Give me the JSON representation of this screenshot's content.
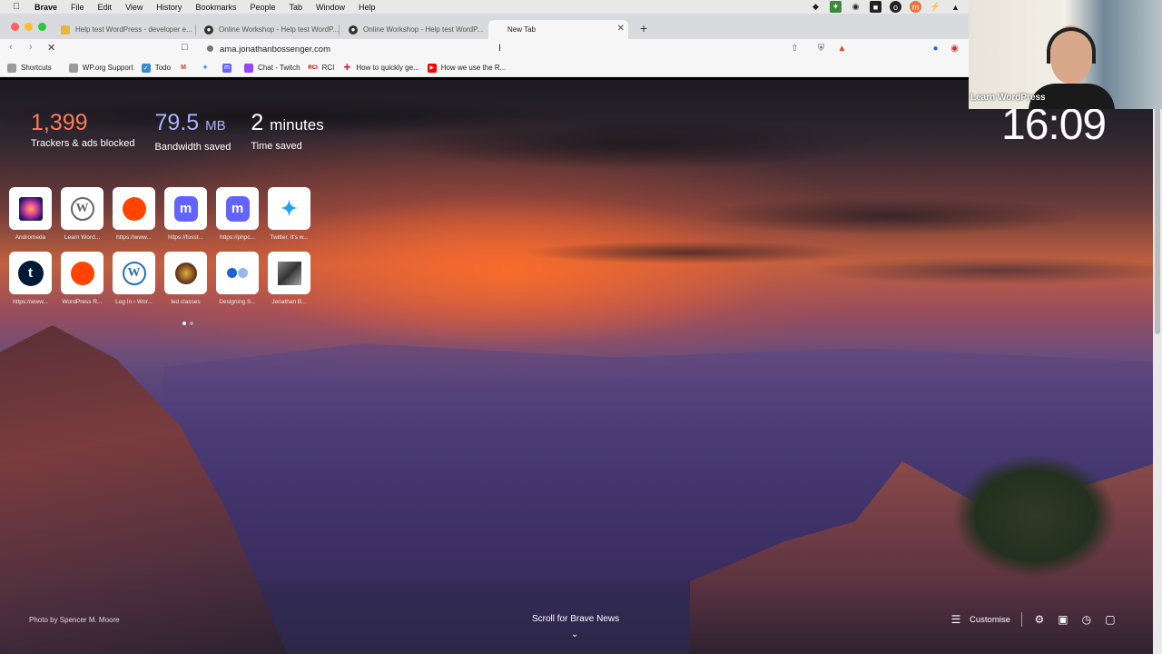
{
  "menubar": {
    "app": "Brave",
    "items": [
      "File",
      "Edit",
      "View",
      "History",
      "Bookmarks",
      "People",
      "Tab",
      "Window",
      "Help"
    ]
  },
  "tabs": [
    {
      "title": "Help test WordPress - developer e...",
      "icon": "wordpress-yellow-icon"
    },
    {
      "title": "Online Workshop - Help test WordP...",
      "icon": "github-icon"
    },
    {
      "title": "Online Workshop - Help test WordP...",
      "icon": "github-icon"
    },
    {
      "title": "New Tab",
      "icon": "blank-icon",
      "active": true
    }
  ],
  "toolbar": {
    "url": "ama.jonathanbossenger.com"
  },
  "bookmarks": [
    {
      "label": "Shortcuts",
      "icon": "folder-icon"
    },
    {
      "label": "WP.org Support",
      "icon": "folder-icon"
    },
    {
      "label": "Todo",
      "icon": "todo-icon"
    },
    {
      "label": "",
      "icon": "gmail-icon"
    },
    {
      "label": "",
      "icon": "twitter-icon"
    },
    {
      "label": "",
      "icon": "mastodon-icon"
    },
    {
      "label": "Chat - Twitch",
      "icon": "twitch-icon"
    },
    {
      "label": "RCI",
      "icon": "rci-icon"
    },
    {
      "label": "How to quickly ge...",
      "icon": "slack-icon"
    },
    {
      "label": "How we use the R...",
      "icon": "youtube-icon"
    }
  ],
  "stats": [
    {
      "value": "1,399",
      "unit": "",
      "label": "Trackers & ads blocked",
      "color": "#ff7a5a"
    },
    {
      "value": "79.5",
      "unit": "MB",
      "label": "Bandwidth saved",
      "color": "#a9b2ff"
    },
    {
      "value": "2",
      "unit": "minutes",
      "label": "Time saved",
      "color": "#ffffff"
    }
  ],
  "top_sites": [
    {
      "caption": "Andromeda",
      "icon": "andromeda-icon"
    },
    {
      "caption": "Learn Word...",
      "icon": "wordpress-icon"
    },
    {
      "caption": "https://www...",
      "icon": "reddit-icon"
    },
    {
      "caption": "https://fosst...",
      "icon": "mastodon-icon"
    },
    {
      "caption": "https://phpc...",
      "icon": "mastodon-icon"
    },
    {
      "caption": "Twitter. It's w...",
      "icon": "twitter-icon"
    },
    {
      "caption": "https://www...",
      "icon": "tumblr-icon"
    },
    {
      "caption": "WordPress R...",
      "icon": "reddit-icon"
    },
    {
      "caption": "Log In ‹ Wor...",
      "icon": "wordpress-icon"
    },
    {
      "caption": "led classes",
      "icon": "led-classes-icon"
    },
    {
      "caption": "Designing S...",
      "icon": "designing-icon"
    },
    {
      "caption": "Jonathan B...",
      "icon": "photo-icon"
    }
  ],
  "clock": "16:09",
  "photo_credit": "Photo by Spencer M. Moore",
  "scroll_news": "Scroll for Brave News",
  "customise": "Customise",
  "webcam_caption": "Learn WordPress"
}
